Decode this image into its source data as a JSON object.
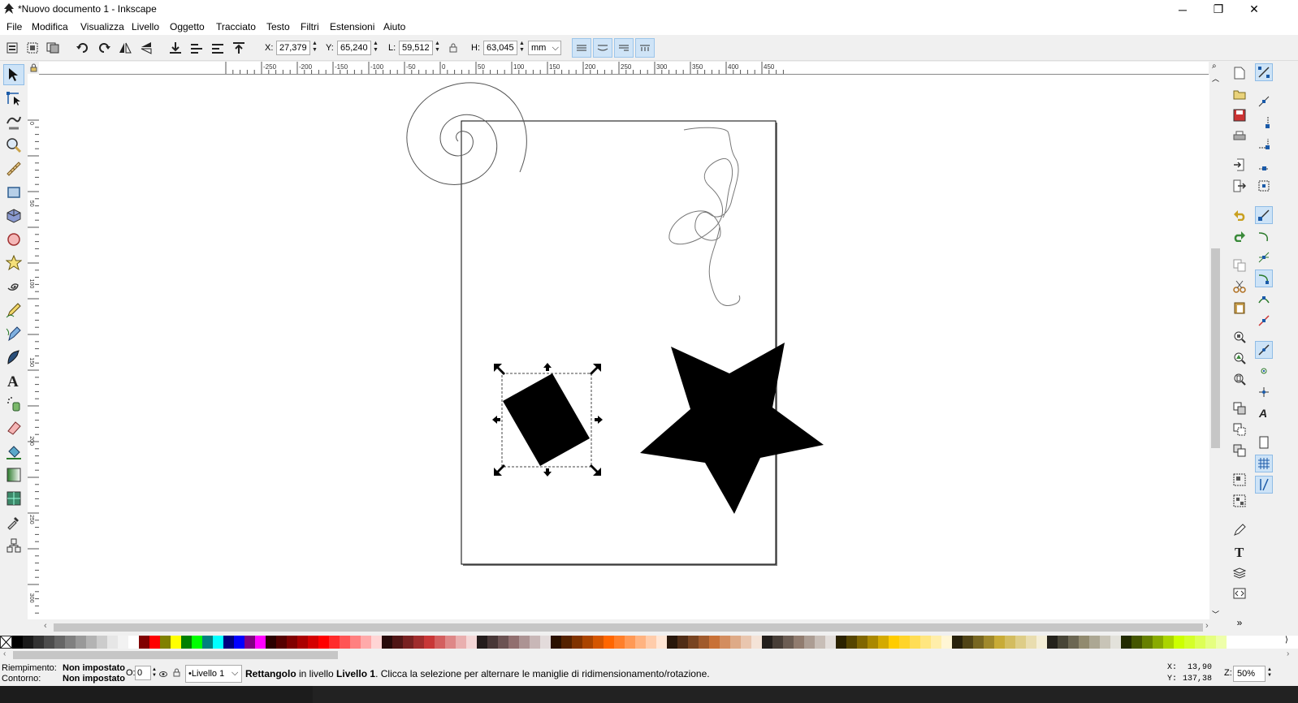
{
  "window": {
    "title": "*Nuovo documento 1 - Inkscape",
    "minimize": "─",
    "maximize": "❐",
    "close": "✕"
  },
  "menu": {
    "items": [
      {
        "label": "File"
      },
      {
        "label": "Modifica"
      },
      {
        "label": "Visualizza"
      },
      {
        "label": "Livello"
      },
      {
        "label": "Oggetto"
      },
      {
        "label": "Tracciato"
      },
      {
        "label": "Testo"
      },
      {
        "label": "Filtri"
      },
      {
        "label": "Estensioni"
      },
      {
        "label": "Aiuto"
      }
    ]
  },
  "controls": {
    "x_label": "X:",
    "x_value": "27,379",
    "y_label": "Y:",
    "y_value": "65,240",
    "w_label": "L:",
    "w_value": "59,512",
    "h_label": "H:",
    "h_value": "63,045",
    "unit": "mm"
  },
  "ruler": {
    "h_ticks": [
      "-250",
      "-200",
      "-150",
      "-100",
      "-50",
      "0",
      "50",
      "100",
      "150",
      "200",
      "250",
      "300",
      "350",
      "400",
      "450"
    ],
    "v_ticks": [
      "0",
      "50",
      "100",
      "150",
      "200",
      "250",
      "300"
    ]
  },
  "status": {
    "fill_label": "Riempimento:",
    "fill_value": "Non impostato",
    "stroke_label": "Contorno:",
    "stroke_value": "Non impostato",
    "opacity_label": "O:",
    "opacity_value": "0",
    "layer": "•Livello 1",
    "message_bold": "Rettangolo",
    "message_mid": " in livello ",
    "message_layer": "Livello 1",
    "message_rest": ". Clicca la selezione per alternare le maniglie di ridimensionamento/rotazione.",
    "cursor_x_label": "X:",
    "cursor_x": "13,90",
    "cursor_y_label": "Y:",
    "cursor_y": "137,38",
    "zoom_label": "Z:",
    "zoom": "50%"
  },
  "palette": {
    "colors": [
      "#000000",
      "#1a1a1a",
      "#333333",
      "#4d4d4d",
      "#666666",
      "#808080",
      "#999999",
      "#b3b3b3",
      "#cccccc",
      "#e6e6e6",
      "#f2f2f2",
      "#ffffff",
      "#800000",
      "#ff0000",
      "#808000",
      "#ffff00",
      "#008000",
      "#00ff00",
      "#008080",
      "#00ffff",
      "#000080",
      "#0000ff",
      "#800080",
      "#ff00ff",
      "#2b0000",
      "#550000",
      "#800000",
      "#aa0000",
      "#d40000",
      "#ff0000",
      "#ff2a2a",
      "#ff5555",
      "#ff8080",
      "#ffaaaa",
      "#ffd5d5",
      "#280b0b",
      "#501616",
      "#782121",
      "#a02c2c",
      "#c83737",
      "#d35f5f",
      "#de8787",
      "#e9afaf",
      "#f4d7d7",
      "#241c1c",
      "#483737",
      "#6c5353",
      "#916f6f",
      "#ac9393",
      "#c8b7b7",
      "#e3dbdb",
      "#2b1100",
      "#552200",
      "#803300",
      "#aa4400",
      "#d45500",
      "#ff6600",
      "#ff7f2a",
      "#ff9955",
      "#ffb380",
      "#ffccaa",
      "#ffe6d5",
      "#28170b",
      "#502d16",
      "#784421",
      "#a05a2c",
      "#c87137",
      "#d38d5f",
      "#deaa87",
      "#e9c6af",
      "#f4e3d7",
      "#241f1c",
      "#483e37",
      "#6c5d53",
      "#917c6f",
      "#ac9d93",
      "#c8beb7",
      "#e3dedb",
      "#2b2200",
      "#554400",
      "#806600",
      "#aa8800",
      "#d4aa00",
      "#ffcc00",
      "#ffd42a",
      "#ffdd55",
      "#ffe680",
      "#ffeeaa",
      "#fff6d5",
      "#28220b",
      "#504416",
      "#786721",
      "#a0892c",
      "#c8ab37",
      "#d3bc5f",
      "#decd87",
      "#e9ddaf",
      "#f4eed7",
      "#24221c",
      "#484537",
      "#6c6753",
      "#918a6f",
      "#aca793",
      "#c8c4b7",
      "#e3e2db",
      "#222b00",
      "#445500",
      "#668000",
      "#88aa00",
      "#aad400",
      "#ccff00",
      "#d4ff2a",
      "#ddff55",
      "#e5ff80",
      "#eeffaa"
    ]
  }
}
